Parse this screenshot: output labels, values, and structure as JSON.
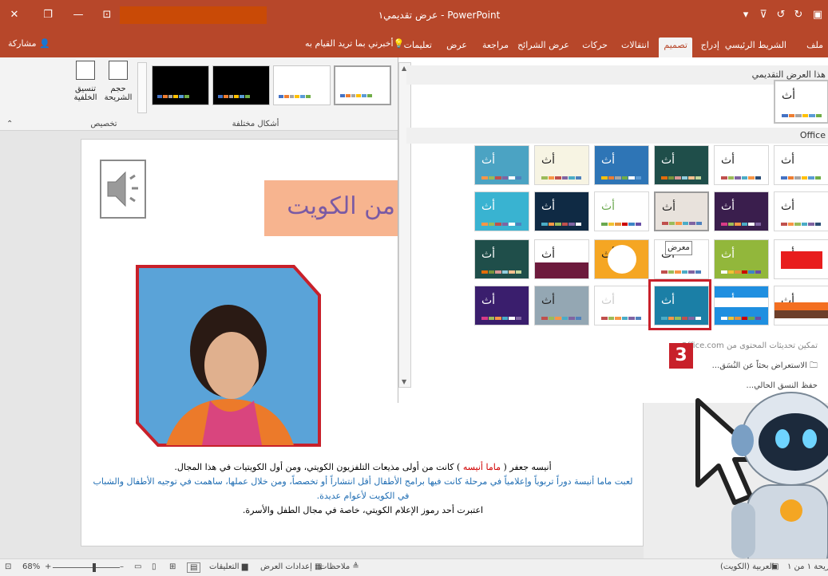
{
  "window": {
    "title": "عرض تقديمي١ - PowerPoint"
  },
  "tabs": [
    {
      "label": "ملف"
    },
    {
      "label": "الشريط الرئيسي"
    },
    {
      "label": "إدراج"
    },
    {
      "label": "تصميم",
      "active": true
    },
    {
      "label": "انتقالات"
    },
    {
      "label": "حركات"
    },
    {
      "label": "عرض الشرائح"
    },
    {
      "label": "مراجعة"
    },
    {
      "label": "عرض"
    },
    {
      "label": "تعليمات"
    }
  ],
  "tell_me": "أخبرني بما تريد القيام به",
  "share": "مشاركة",
  "ribbon": {
    "variants_label": "أشكال مختلفة",
    "customize_label": "تخصيص",
    "slide_size_label": "حجم الشريحة",
    "format_bg_label": "تنسيق الخلفية"
  },
  "slide": {
    "title": "من الكويت",
    "caption_line1_before": "أنيسه جعفر ( ",
    "caption_line1_highlight": "ماما أنيسه",
    "caption_line1_after": " ) كانت من أولى مذيعات التلفزيون الكويتي، ومن أول الكويتيات في هذا المجال.",
    "caption_line2": "لعبت ماما أنيسة دوراً تربوياً وإعلامياً في مرحلة كانت فيها برامج الأطفال أقل انتشاراً أو تخصصاً، ومن خلال عملها، ساهمت في توجيه الأطفال والشباب في الكويت لأعوام عديدة.",
    "caption_line3": "اعتبرت أحد رموز الإعلام الكويتي، خاصة في مجال الطفل والأسرة."
  },
  "gallery": {
    "this_presentation_label": "هذا العرض التقديمي",
    "office_label": "Office",
    "tile_label": "أث",
    "tooltip": "معرض",
    "cmd_enable_updates": "تمكين تحديثات المحتوى من Office.com",
    "cmd_browse": "الاستعراض بحثاً عن النُسَق...",
    "cmd_save": "حفظ النسق الحالي..."
  },
  "badge": "3",
  "status": {
    "slide_count": "الشريحة ١ من ١",
    "language": "العربية (الكويت)",
    "notes": "ملاحظات",
    "display_settings": "إعدادات العرض",
    "comments": "التعليقات",
    "zoom": "68%"
  },
  "colors": {
    "brand": "#b7472a",
    "selection": "#c8202a",
    "caption_blue": "#1f6db3"
  }
}
